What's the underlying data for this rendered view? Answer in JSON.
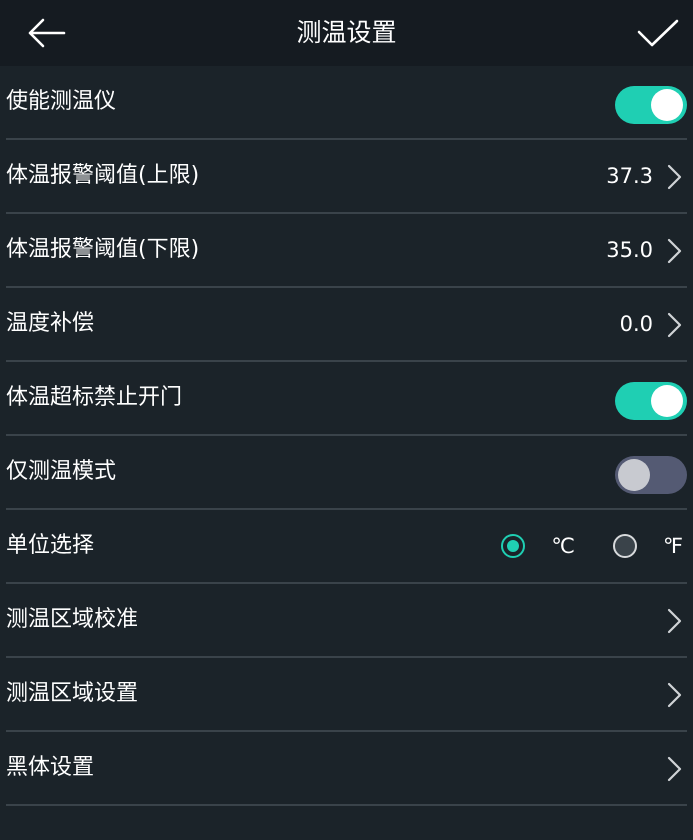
{
  "header": {
    "title": "测温设置",
    "back_icon": "arrow-left-icon",
    "confirm_icon": "check-icon"
  },
  "colors": {
    "background": "#1b2329",
    "header": "#151b21",
    "accent": "#1fcfb3",
    "divider": "#3a434a",
    "toggle_off": "#545a73"
  },
  "settings": {
    "enable_thermometer": {
      "label": "使能测温仪",
      "enabled": true
    },
    "alarm_upper": {
      "label": "体温报警阈值(上限)",
      "value": "37.3"
    },
    "alarm_lower": {
      "label": "体温报警阈值(下限)",
      "value": "35.0"
    },
    "temp_compensation": {
      "label": "温度补偿",
      "value": "0.0"
    },
    "block_door_over_temp": {
      "label": "体温超标禁止开门",
      "enabled": true
    },
    "temp_only_mode": {
      "label": "仅测温模式",
      "enabled": false
    },
    "unit_select": {
      "label": "单位选择",
      "options": [
        "℃",
        "℉"
      ],
      "selected": "℃"
    },
    "area_calibration": {
      "label": "测温区域校准"
    },
    "area_settings": {
      "label": "测温区域设置"
    },
    "blackbody_settings": {
      "label": "黑体设置"
    }
  }
}
